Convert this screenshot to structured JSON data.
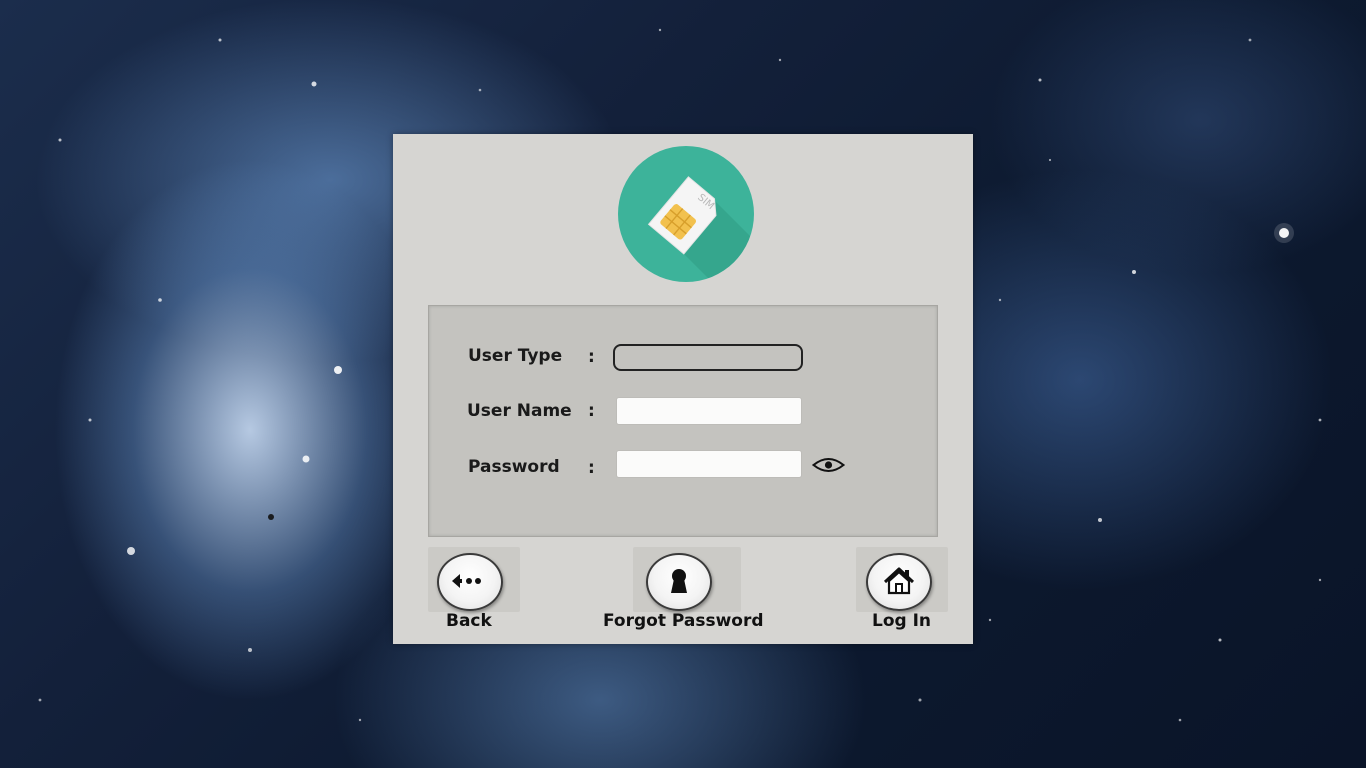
{
  "form": {
    "user_type_label": "User Type",
    "user_name_label": "User Name",
    "password_label": "Password",
    "colon": ":",
    "user_type_value": "",
    "user_name_value": "",
    "password_value": ""
  },
  "logo": {
    "icon": "sim-card-icon",
    "text": "SIM",
    "color": "#3db39a"
  },
  "actions": {
    "back_label": "Back",
    "forgot_password_label": "Forgot Password",
    "login_label": "Log In"
  },
  "colors": {
    "dialog_bg": "#d6d5d2",
    "panel_bg": "#c4c3bf",
    "accent": "#3db39a",
    "chip": "#f2c14e"
  }
}
